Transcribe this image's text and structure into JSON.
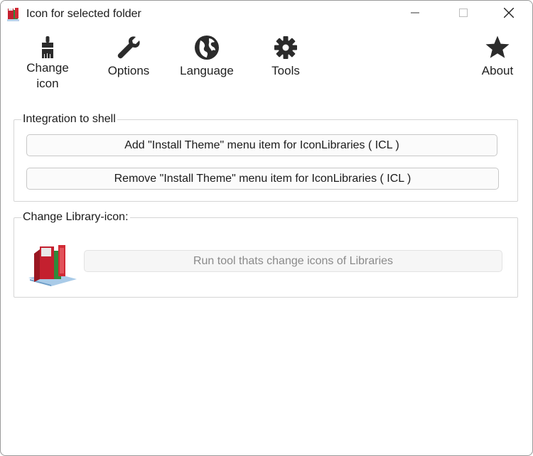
{
  "window": {
    "title": "Icon for selected folder",
    "app_icon": "folder-library-icon"
  },
  "titlebar_buttons": {
    "minimize_icon": "minimize-icon",
    "maximize_icon": "maximize-icon",
    "close_icon": "close-icon"
  },
  "toolbar": {
    "change_icon": {
      "label_line1": "Change",
      "label_line2": "icon",
      "icon": "brush-icon"
    },
    "options": {
      "label": "Options",
      "icon": "wrench-icon"
    },
    "language": {
      "label": "Language",
      "icon": "globe-icon"
    },
    "tools": {
      "label": "Tools",
      "icon": "gear-icon"
    },
    "about": {
      "label": "About",
      "icon": "star-icon"
    }
  },
  "integration": {
    "title": "Integration to shell",
    "add_button": "Add \"Install Theme\" menu item for IconLibraries ( ICL )",
    "remove_button": "Remove \"Install Theme\" menu item for IconLibraries ( ICL )"
  },
  "library": {
    "title": "Change Library-icon:",
    "icon": "library-folder-icon",
    "run_button": "Run tool thats change icons of Libraries"
  },
  "colors": {
    "accent_red": "#c4202f",
    "accent_green": "#2e8a3a",
    "icon_dark": "#2b2b2b"
  }
}
